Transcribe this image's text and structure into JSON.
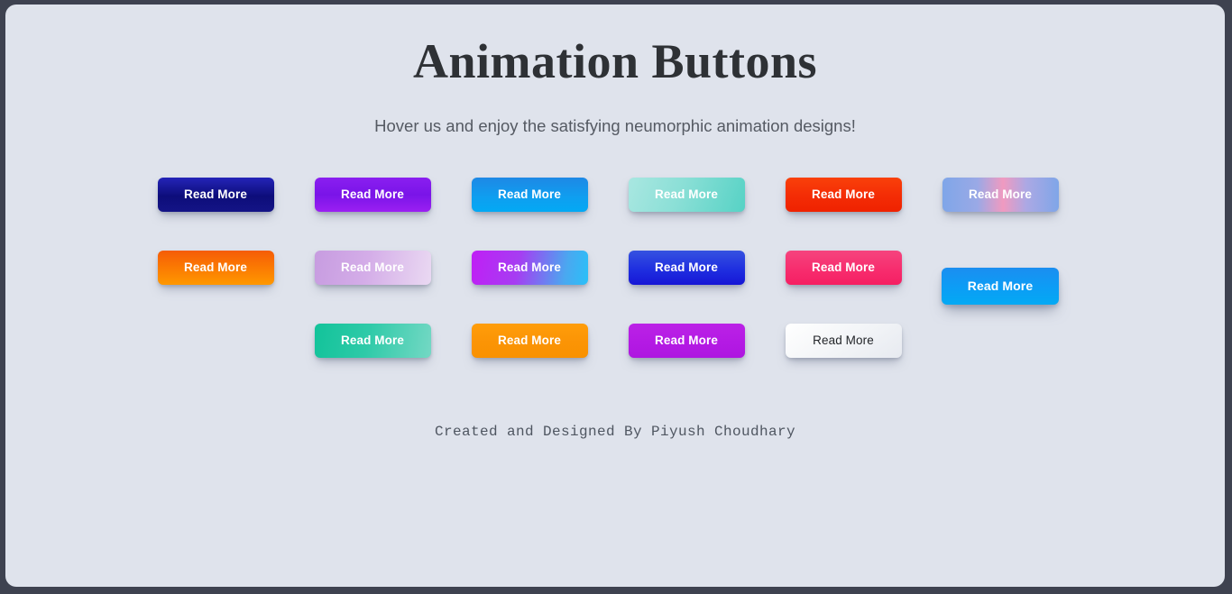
{
  "page": {
    "title": "Animation Buttons",
    "subtitle": "Hover us and enjoy the satisfying neumorphic animation designs!",
    "footer": "Created and Designed By Piyush Choudhary",
    "background": "#dfe3ec",
    "frame_color": "#3e4250",
    "title_color": "#2e3135",
    "subtitle_color": "#555a63",
    "footer_color": "#4f5661"
  },
  "buttons": [
    {
      "label": "Read More",
      "name": "read-more-button-1",
      "gradient": "linear-gradient(180deg, #2424b8 0%, #0d0d7a 55%, #141486 100%)",
      "text_color": "#ffffff",
      "state": "normal"
    },
    {
      "label": "Read More",
      "name": "read-more-button-2",
      "gradient": "linear-gradient(180deg, #8a1ff0 0%, #7a14e8 50%, #9b1ff2 100%)",
      "text_color": "#ffffff",
      "state": "normal"
    },
    {
      "label": "Read More",
      "name": "read-more-button-3",
      "gradient": "linear-gradient(180deg, #1e88e5 0%, #0e9ff0 60%, #03a9f4 100%)",
      "text_color": "#ffffff",
      "state": "normal"
    },
    {
      "label": "Read More",
      "name": "read-more-button-4",
      "gradient": "linear-gradient(110deg, #a9e7e1 0%, #8adfd6 45%, #56d2c5 100%)",
      "text_color": "#ffffff",
      "state": "normal"
    },
    {
      "label": "Read More",
      "name": "read-more-button-5",
      "gradient": "linear-gradient(180deg, #f9410a 0%, #f42c05 55%, #ef2200 100%)",
      "text_color": "#ffffff",
      "state": "normal"
    },
    {
      "label": "Read More",
      "name": "read-more-button-6",
      "gradient": "linear-gradient(90deg, #7fa6e8 0%, #9aa9e6 30%, #f09ac0 52%, #aca8e4 72%, #7fa6e8 100%)",
      "text_color": "#ffffff",
      "state": "normal"
    },
    {
      "label": "Read More",
      "name": "read-more-button-7",
      "gradient": "linear-gradient(180deg, #f55c07 0%, #fb7a02 50%, #ff9800 100%)",
      "text_color": "#ffffff",
      "state": "normal"
    },
    {
      "label": "Read More",
      "name": "read-more-button-8",
      "gradient": "linear-gradient(100deg, #c79ce0 0%, #d4ade8 45%, #ead9f2 100%)",
      "text_color": "#ffffff",
      "state": "normal"
    },
    {
      "label": "Read More",
      "name": "read-more-button-9",
      "gradient": "linear-gradient(100deg, #c01ff5 0%, #a63df2 40%, #4aa8f0 80%, #29c0f8 100%)",
      "text_color": "#ffffff",
      "state": "normal"
    },
    {
      "label": "Read More",
      "name": "read-more-button-10",
      "gradient": "linear-gradient(180deg, #3652e0 0%, #1f2fe0 55%, #1616d6 100%)",
      "text_color": "#ffffff",
      "state": "normal"
    },
    {
      "label": "Read More",
      "name": "read-more-button-11",
      "gradient": "linear-gradient(180deg, #f5447e 0%, #f72d6e 55%, #f61f63 100%)",
      "text_color": "#ffffff",
      "state": "normal"
    },
    {
      "label": "Read More",
      "name": "read-more-button-12",
      "gradient": "linear-gradient(180deg, #1b8ef0 0%, #0d9cf5 50%, #03a9f4 100%)",
      "text_color": "#ffffff",
      "state": "hovered"
    },
    {
      "label": "Read More",
      "name": "read-more-button-13",
      "gradient": "linear-gradient(100deg, #12c39a 0%, #2ecaa8 45%, #74d8c4 100%)",
      "text_color": "#ffffff",
      "state": "normal"
    },
    {
      "label": "Read More",
      "name": "read-more-button-14",
      "gradient": "linear-gradient(180deg, #ff9d0a 0%, #fb9405 55%, #f99100 100%)",
      "text_color": "#ffffff",
      "state": "normal"
    },
    {
      "label": "Read More",
      "name": "read-more-button-15",
      "gradient": "linear-gradient(180deg, #bb22e6 0%, #b41ae4 55%, #ae16e0 100%)",
      "text_color": "#ffffff",
      "state": "normal"
    },
    {
      "label": "Read More",
      "name": "read-more-button-16",
      "gradient": "linear-gradient(145deg, #ffffff 0%, #f2f4f7 55%, #e7eaf0 100%)",
      "text_color": "#222529",
      "state": "normal"
    }
  ],
  "layout": {
    "row_breaks": [
      6,
      12
    ],
    "row3_leading_empty_cells": 1
  }
}
